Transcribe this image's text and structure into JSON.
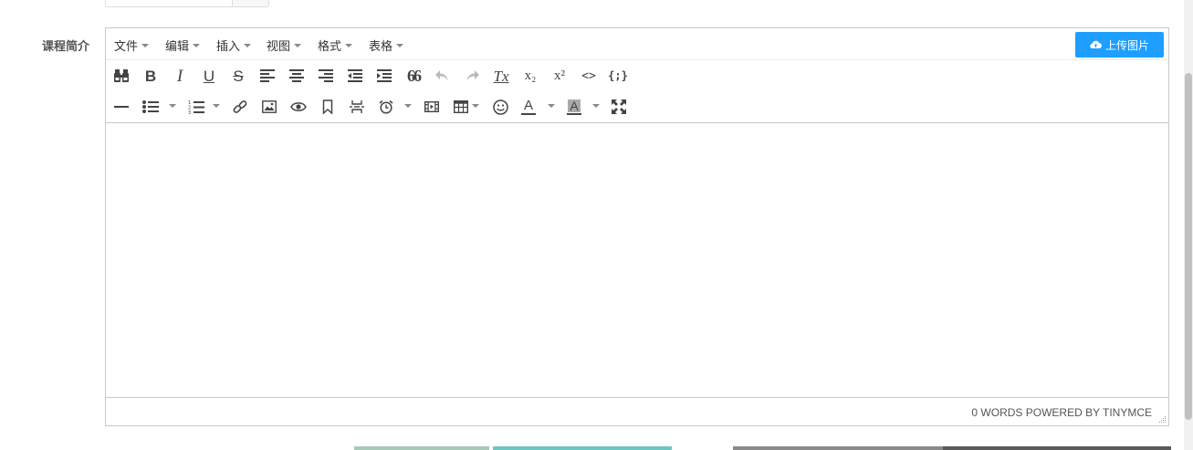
{
  "form": {
    "label": "课程简介"
  },
  "menubar": {
    "items": [
      {
        "label": "文件"
      },
      {
        "label": "编辑"
      },
      {
        "label": "插入"
      },
      {
        "label": "视图"
      },
      {
        "label": "格式"
      },
      {
        "label": "表格"
      }
    ],
    "upload_button": "上传图片"
  },
  "toolbar": {
    "row1": [
      "find-replace",
      "bold",
      "italic",
      "underline",
      "strikethrough",
      "align-left",
      "align-center",
      "align-right",
      "outdent",
      "indent",
      "blockquote",
      "undo",
      "redo",
      "remove-format",
      "subscript",
      "superscript",
      "code",
      "code-sample"
    ],
    "row2": [
      "horizontal-rule",
      "bullet-list",
      "numbered-list",
      "link",
      "image",
      "preview",
      "anchor",
      "page-break",
      "insert-datetime",
      "media",
      "table",
      "emoticons",
      "text-color",
      "background-color",
      "fullscreen"
    ],
    "bold_glyph": "B",
    "italic_glyph": "I",
    "underline_glyph": "U",
    "strike_glyph": "S",
    "text_color_glyph": "A",
    "bg_color_glyph": "A",
    "subscript_glyph": "x₂",
    "superscript_glyph": "x²",
    "code_glyph": "<>",
    "code_sample_glyph": "{;}",
    "blockquote_glyph": "66",
    "remove_format_glyph": "Tx"
  },
  "statusbar": {
    "text": "0 WORDS POWERED BY TINYMCE"
  },
  "colors": {
    "accent": "#1e9fff",
    "border": "#c9c9c9",
    "icon": "#444444"
  }
}
